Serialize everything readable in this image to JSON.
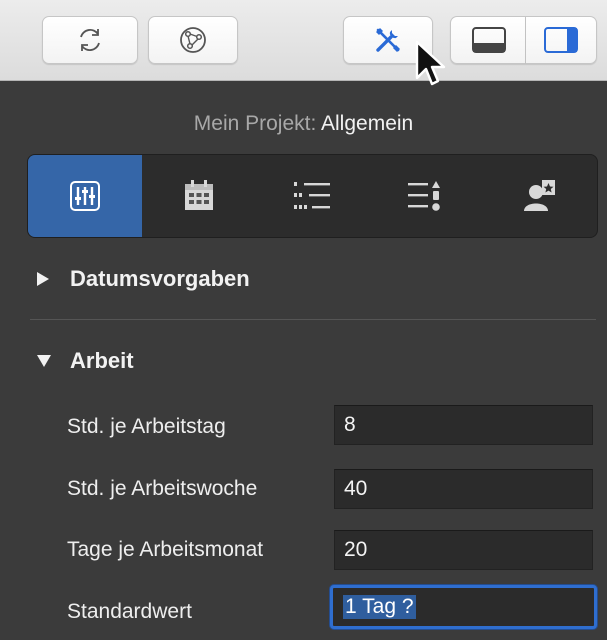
{
  "toolbar": {
    "buttons": [
      {
        "icon": "refresh-icon"
      },
      {
        "icon": "network-icon"
      },
      {
        "icon": "tools-icon",
        "state": "active"
      },
      {
        "icon": "bottom-panel-icon"
      },
      {
        "icon": "right-panel-icon",
        "state": "active"
      }
    ]
  },
  "header": {
    "project_prefix": "Mein Projekt:",
    "section": "Allgemein"
  },
  "tabs": [
    {
      "icon": "sliders-icon",
      "active": true
    },
    {
      "icon": "calendar-icon",
      "active": false
    },
    {
      "icon": "list-icon",
      "active": false
    },
    {
      "icon": "sort-list-icon",
      "active": false
    },
    {
      "icon": "user-badge-icon",
      "active": false
    }
  ],
  "sections": {
    "datumsvorgaben": {
      "label": "Datumsvorgaben",
      "expanded": false
    },
    "arbeit": {
      "label": "Arbeit",
      "expanded": true
    }
  },
  "fields": {
    "hours_per_day": {
      "label": "Std. je Arbeitstag",
      "value": "8"
    },
    "hours_per_week": {
      "label": "Std. je Arbeitswoche",
      "value": "40"
    },
    "days_per_month": {
      "label": "Tage je Arbeitsmonat",
      "value": "20"
    },
    "default_value": {
      "label": "Standardwert",
      "value": "1 Tag ?"
    }
  },
  "colors": {
    "accent": "#3566a8",
    "panel_bg": "#3b3b3b",
    "focus_ring": "#2f6ecf"
  }
}
